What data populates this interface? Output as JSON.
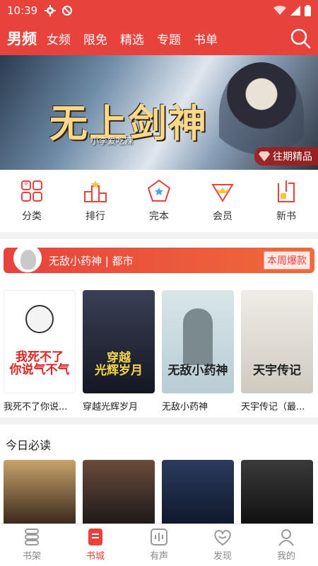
{
  "status": {
    "time": "10:39"
  },
  "nav": {
    "active": "男频",
    "tabs": [
      "女频",
      "限免",
      "精选",
      "专题",
      "书单"
    ]
  },
  "banner": {
    "title": "无上剑神",
    "author": "小李爱吃辣",
    "badge": "往期精品"
  },
  "quick": [
    {
      "label": "分类",
      "icon": "grid-icon"
    },
    {
      "label": "排行",
      "icon": "podium-icon"
    },
    {
      "label": "完本",
      "icon": "pentagon-icon"
    },
    {
      "label": "会员",
      "icon": "crown-icon"
    },
    {
      "label": "新书",
      "icon": "new-book-icon"
    }
  ],
  "promo": {
    "title": "无敌小药神 | 都市",
    "hot": "本周爆款"
  },
  "books": [
    {
      "title": "我死不了你说...",
      "cover_text": "我死不了\n你说气不气",
      "bg": "#ffffff",
      "fg": "#d22"
    },
    {
      "title": "穿越光辉岁月",
      "cover_text": "穿越\n光辉岁月",
      "bg": "#1e2233",
      "fg": "#f2d34a"
    },
    {
      "title": "无敌小药神",
      "cover_text": "无敌小药神",
      "bg": "#c9dbe2",
      "fg": "#222"
    },
    {
      "title": "天宇传记（最...",
      "cover_text": "天宇传记",
      "bg": "#e6e2d8",
      "fg": "#222"
    }
  ],
  "today": {
    "heading": "今日必读"
  },
  "tabbar": [
    {
      "label": "书架",
      "icon": "bookshelf-icon",
      "active": false
    },
    {
      "label": "书城",
      "icon": "bookstore-icon",
      "active": true
    },
    {
      "label": "有声",
      "icon": "audio-icon",
      "active": false
    },
    {
      "label": "发现",
      "icon": "discover-icon",
      "active": false
    },
    {
      "label": "我的",
      "icon": "profile-icon",
      "active": false
    }
  ],
  "colors": {
    "brand": "#e8423d"
  }
}
